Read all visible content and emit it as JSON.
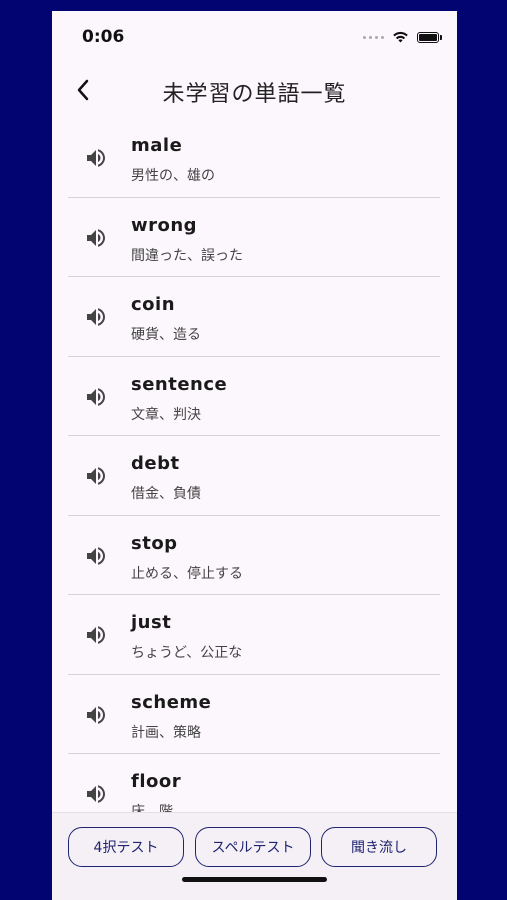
{
  "status_bar": {
    "time": "0:06"
  },
  "header": {
    "title": "未学習の単語一覧",
    "back_icon": "chevron-left-icon"
  },
  "words": [
    {
      "word": "male",
      "meaning": "男性の、雄の"
    },
    {
      "word": "wrong",
      "meaning": "間違った、誤った"
    },
    {
      "word": "coin",
      "meaning": "硬貨、造る"
    },
    {
      "word": "sentence",
      "meaning": "文章、判決"
    },
    {
      "word": "debt",
      "meaning": "借金、負債"
    },
    {
      "word": "stop",
      "meaning": "止める、停止する"
    },
    {
      "word": "just",
      "meaning": "ちょうど、公正な"
    },
    {
      "word": "scheme",
      "meaning": "計画、策略"
    },
    {
      "word": "floor",
      "meaning": "床、階"
    }
  ],
  "bottom_actions": {
    "quiz_label": "4択テスト",
    "spell_label": "スペルテスト",
    "listen_label": "聞き流し"
  },
  "colors": {
    "background": "#020472",
    "screen": "#FCF7FC",
    "accent": "#1f2470"
  }
}
